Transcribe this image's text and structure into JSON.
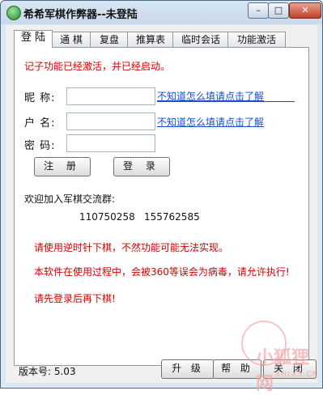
{
  "window": {
    "title": "希希军棋作弊器--未登陆",
    "min_label": "–",
    "max_label": "□",
    "close_label": "✕"
  },
  "tabs": [
    {
      "label": "登 陆",
      "active": true
    },
    {
      "label": "通 棋",
      "active": false
    },
    {
      "label": "复盘",
      "active": false
    },
    {
      "label": "推算表",
      "active": false
    },
    {
      "label": "临时会话",
      "active": false
    },
    {
      "label": "功能激活",
      "active": false
    }
  ],
  "login": {
    "notice": "记子功能已经激活，并已经启动。",
    "nickname_label": "昵  称:",
    "nickname_value": "",
    "account_label": "户  名:",
    "account_value": "",
    "password_label": "密  码:",
    "password_value": "",
    "help_link_1": "不知道怎么填请点击了解",
    "help_link_2": "不知道怎么填请点击了解",
    "register_button": "注 册",
    "login_button": "登 录",
    "group_title": "欢迎加入军棋交流群:",
    "group_1": "110750258",
    "group_2": "155762585",
    "tip_1": "请使用逆时针下棋，不然功能可能无法实现。",
    "tip_2": "本软件在使用过程中，会被360等误会为病毒，请允许执行!",
    "tip_3": "请先登录后再下棋!"
  },
  "footer": {
    "version_label": "版本号: 5.03",
    "upgrade_button": "升 级",
    "help_button": "帮 助",
    "close_button": "关 闭"
  },
  "watermark": {
    "text": "小狐狸网",
    "sub": "XHLKS.CN"
  },
  "colors": {
    "accent_red": "#d40000",
    "link_blue": "#1a4fd0"
  }
}
